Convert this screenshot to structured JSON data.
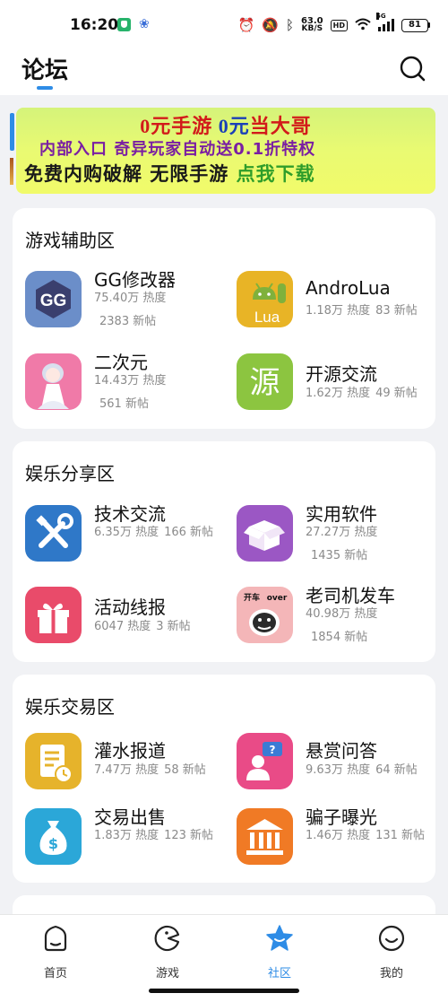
{
  "status_bar": {
    "time": "16:20",
    "net_speed_value": "63.0",
    "net_speed_unit": "KB/S",
    "hd_label": "HD",
    "signal_label": "5G",
    "battery": "81"
  },
  "header": {
    "title": "论坛"
  },
  "banner": {
    "line1_a": "0元手游",
    "line1_b": "0元",
    "line1_c": "当大哥",
    "line2": "内部入口   奇异玩家自动送0.1折特权",
    "line3_a": "免费内购破解 无限手游 ",
    "line3_b": "点我下载"
  },
  "sections": [
    {
      "title": "游戏辅助区",
      "items": [
        {
          "name": "GG修改器",
          "stat_heat": "75.40万 热度",
          "stat_posts": "2383 新帖"
        },
        {
          "name": "AndroLua",
          "stat_heat": "1.18万 热度",
          "stat_posts": "83 新帖"
        },
        {
          "name": "二次元",
          "stat_heat": "14.43万 热度",
          "stat_posts": "561 新帖"
        },
        {
          "name": "开源交流",
          "stat_heat": "1.62万 热度",
          "stat_posts": "49 新帖"
        }
      ]
    },
    {
      "title": "娱乐分享区",
      "items": [
        {
          "name": "技术交流",
          "stat_heat": "6.35万 热度",
          "stat_posts": "166 新帖"
        },
        {
          "name": "实用软件",
          "stat_heat": "27.27万 热度",
          "stat_posts": "1435 新帖"
        },
        {
          "name": "活动线报",
          "stat_heat": "6047 热度",
          "stat_posts": "3 新帖"
        },
        {
          "name": "老司机发车",
          "stat_heat": "40.98万 热度",
          "stat_posts": "1854 新帖"
        }
      ]
    },
    {
      "title": "娱乐交易区",
      "items": [
        {
          "name": "灌水报道",
          "stat_heat": "7.47万 热度",
          "stat_posts": "58 新帖"
        },
        {
          "name": "悬赏问答",
          "stat_heat": "9.63万 热度",
          "stat_posts": "64 新帖"
        },
        {
          "name": "交易出售",
          "stat_heat": "1.83万 热度",
          "stat_posts": "123 新帖"
        },
        {
          "name": "骗子曝光",
          "stat_heat": "1.46万 热度",
          "stat_posts": "131 新帖"
        }
      ]
    }
  ],
  "icon_texts": {
    "gg": "GG",
    "lua": "Lua",
    "source": "源",
    "meme_a": "开车",
    "meme_b": "over"
  },
  "nav": [
    {
      "label": "首页",
      "icon": "home-icon"
    },
    {
      "label": "游戏",
      "icon": "game-icon"
    },
    {
      "label": "社区",
      "icon": "community-star-icon",
      "active": true
    },
    {
      "label": "我的",
      "icon": "profile-icon"
    }
  ],
  "colors": {
    "accent": "#2e8ce6"
  }
}
